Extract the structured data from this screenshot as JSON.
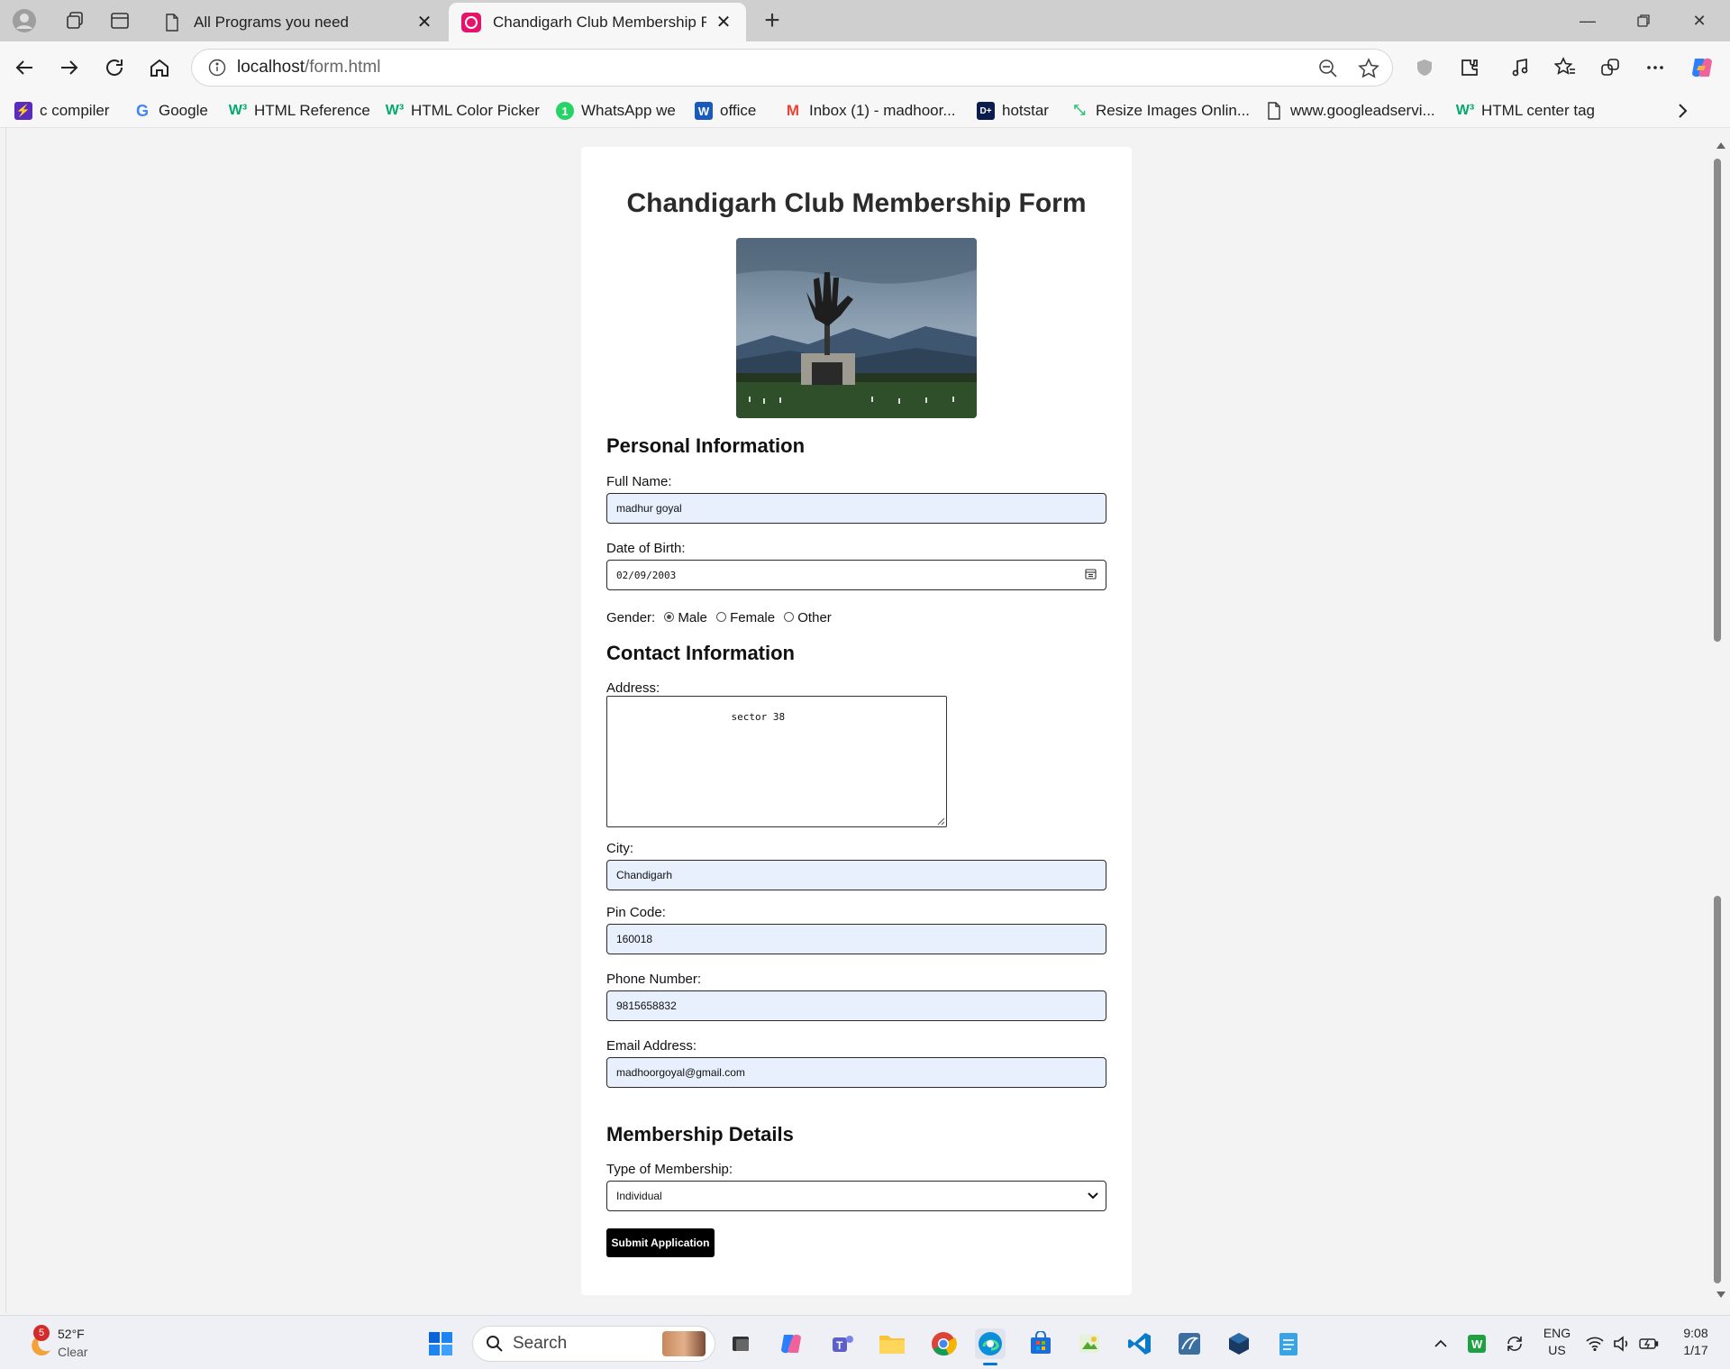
{
  "browser": {
    "tabs": [
      {
        "title": "All Programs you need"
      },
      {
        "title": "Chandigarh Club Membership For"
      }
    ],
    "address": {
      "host": "localhost",
      "path": "/form.html"
    },
    "bookmarks": [
      {
        "label": "c compiler"
      },
      {
        "label": "Google"
      },
      {
        "label": "HTML Reference"
      },
      {
        "label": "HTML Color Picker"
      },
      {
        "label": "WhatsApp we"
      },
      {
        "label": "office"
      },
      {
        "label": "Inbox (1) - madhoor..."
      },
      {
        "label": "hotstar"
      },
      {
        "label": "Resize Images Onlin..."
      },
      {
        "label": "www.googleadservi..."
      },
      {
        "label": "HTML center tag"
      }
    ]
  },
  "form": {
    "title": "Chandigarh Club Membership Form",
    "personal": {
      "heading": "Personal Information",
      "full_name_label": "Full Name:",
      "full_name_value": "madhur goyal",
      "dob_label": "Date of Birth:",
      "dob_value": "02/09/2003",
      "gender_label": "Gender:",
      "gender_options": [
        "Male",
        "Female",
        "Other"
      ],
      "gender_selected": "Male"
    },
    "contact": {
      "heading": "Contact Information",
      "address_label": "Address:",
      "address_value": "sector 38",
      "city_label": "City:",
      "city_value": "Chandigarh",
      "pin_label": "Pin Code:",
      "pin_value": "160018",
      "phone_label": "Phone Number:",
      "phone_value": "9815658832",
      "email_label": "Email Address:",
      "email_value": "madhoorgoyal@gmail.com"
    },
    "membership": {
      "heading": "Membership Details",
      "type_label": "Type of Membership:",
      "type_value": "Individual"
    },
    "submit_label": "Submit Application"
  },
  "taskbar": {
    "weather_temp": "52°F",
    "weather_desc": "Clear",
    "weather_badge": "5",
    "search_placeholder": "Search",
    "lang_top": "ENG",
    "lang_bottom": "US",
    "time": "9:08",
    "date": "1/17"
  },
  "colors": {
    "accent_edge": "#0078d4",
    "autofill_bg": "#e8f0fe",
    "submit_bg": "#000000"
  }
}
